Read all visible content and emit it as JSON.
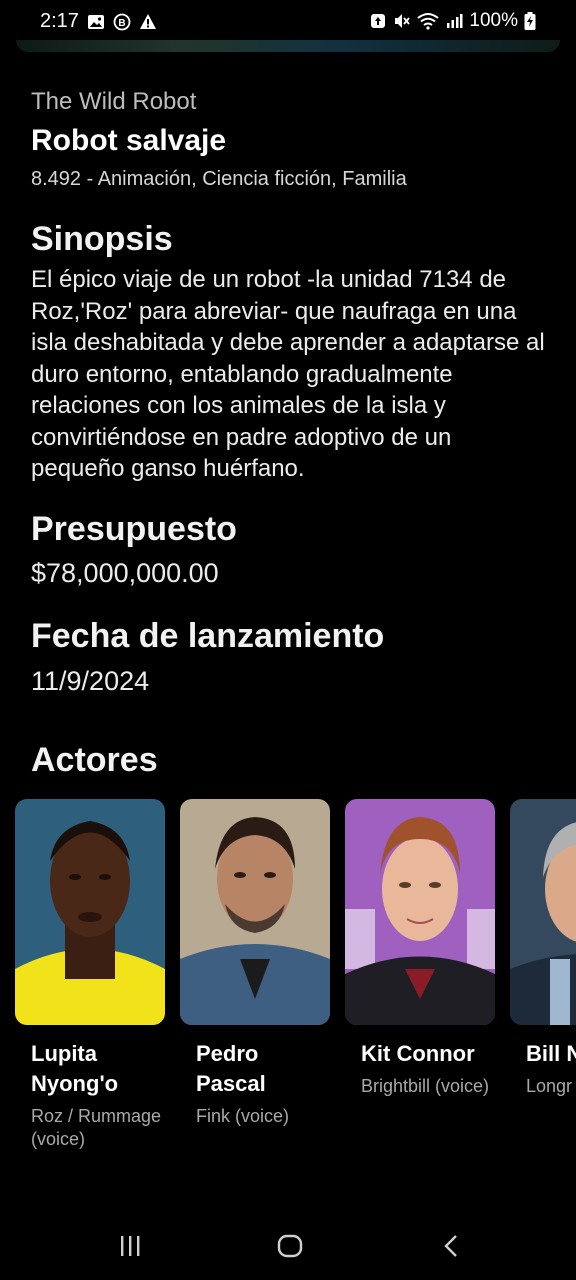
{
  "status_bar": {
    "time": "2:17",
    "battery": "100%",
    "left_icons": [
      "gallery-icon",
      "b-badge-icon",
      "warning-icon"
    ],
    "right_icons": [
      "sync-icon",
      "mute-icon",
      "wifi-icon",
      "signal-icon",
      "battery-charging-icon"
    ]
  },
  "movie": {
    "original_title": "The Wild Robot",
    "title": "Robot salvaje",
    "meta": "8.492 - Animación, Ciencia ficción, Familia"
  },
  "synopsis": {
    "heading": "Sinopsis",
    "text": "El épico viaje de un robot -la unidad 7134 de Roz,'Roz' para abreviar- que naufraga en una isla deshabitada y debe aprender a adaptarse al duro entorno, entablando gradualmente relaciones con los animales de la isla y convirtiéndose en padre adoptivo de un pequeño ganso huérfano."
  },
  "budget": {
    "heading": "Presupuesto",
    "value": "$78,000,000.00"
  },
  "release": {
    "heading": "Fecha de lanzamiento",
    "value": "11/9/2024"
  },
  "actors": {
    "heading": "Actores",
    "items": [
      {
        "name": "Lupita Nyong'o",
        "role": "Roz / Rummage (voice)"
      },
      {
        "name": "Pedro Pascal",
        "role": "Fink (voice)"
      },
      {
        "name": "Kit Connor",
        "role": "Brightbill (voice)"
      },
      {
        "name": "Bill N",
        "role": "Longr (voice"
      }
    ]
  },
  "nav_bar": {
    "icons": [
      "recent-apps-icon",
      "home-icon",
      "back-icon"
    ]
  }
}
